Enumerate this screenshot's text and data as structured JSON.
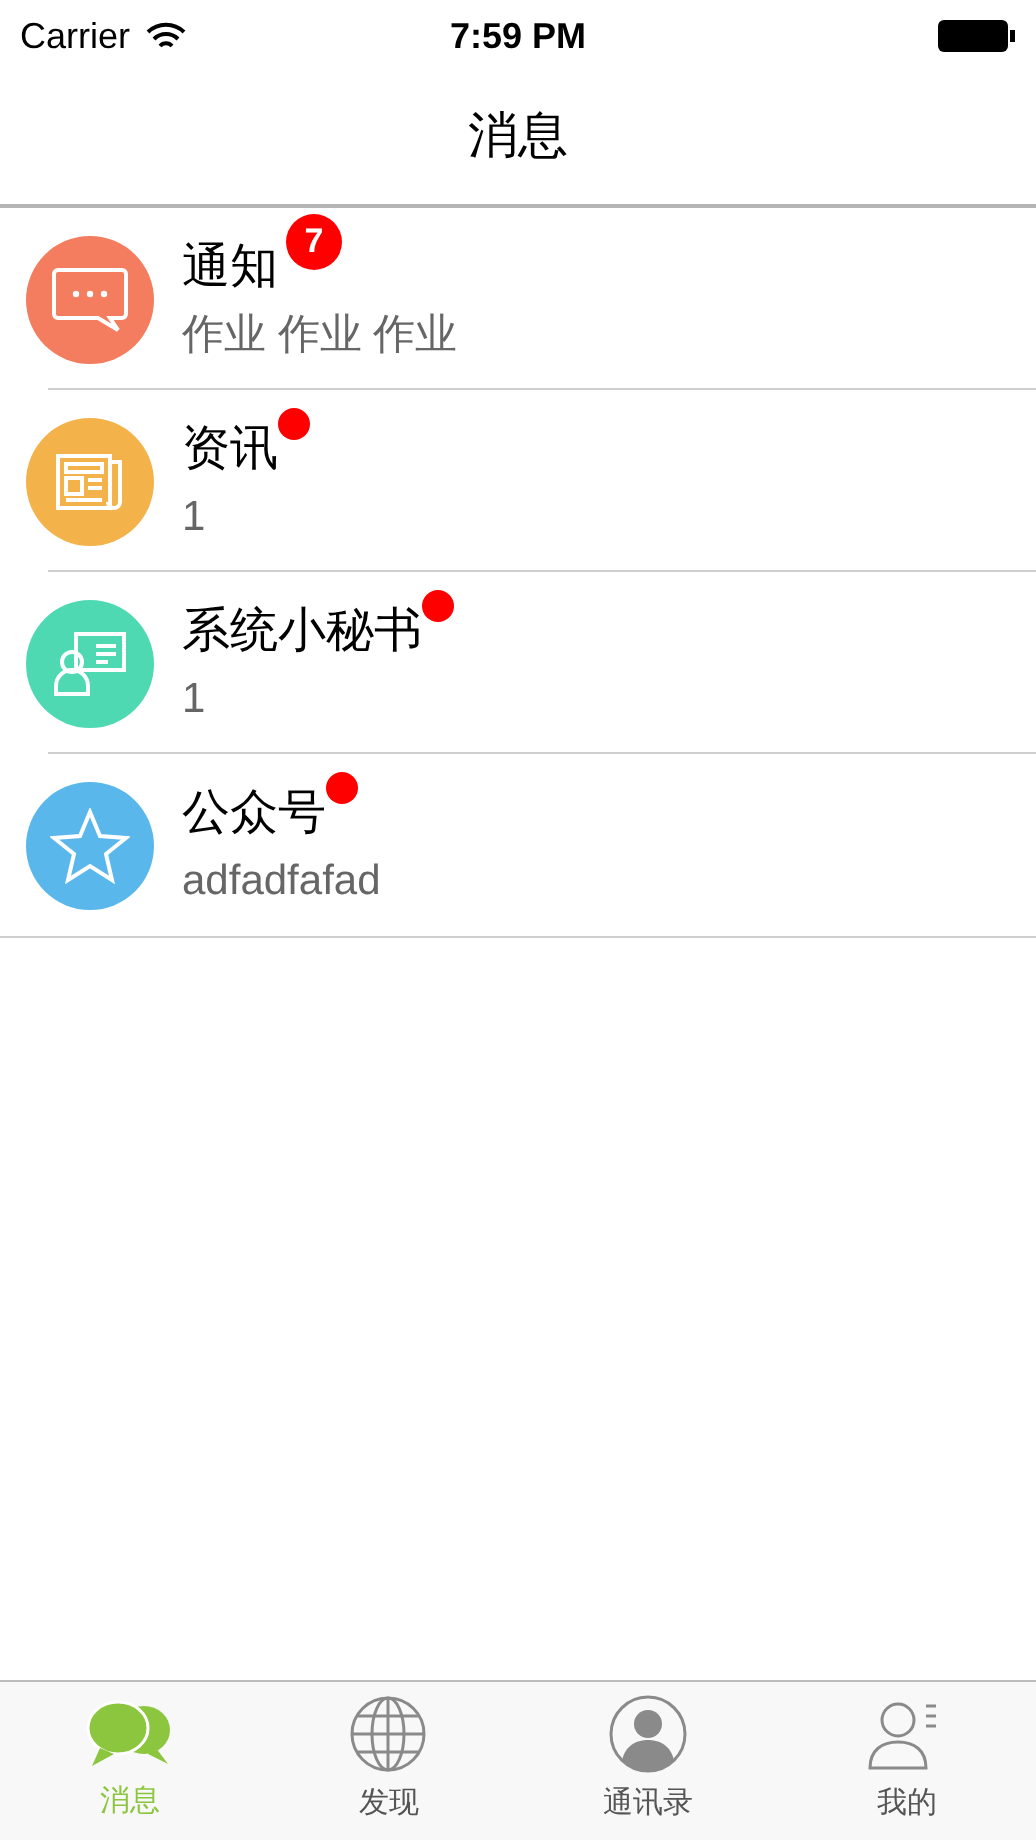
{
  "status_bar": {
    "carrier": "Carrier",
    "time": "7:59 PM"
  },
  "nav": {
    "title": "消息"
  },
  "items": [
    {
      "color": "#f47c5f",
      "title": "通知",
      "badge": {
        "kind": "count",
        "text": "7"
      },
      "subtitle": "作业 作业 作业"
    },
    {
      "color": "#f3b24a",
      "title": "资讯",
      "badge": {
        "kind": "dot"
      },
      "subtitle": "1"
    },
    {
      "color": "#4fd9b3",
      "title": "系统小秘书",
      "badge": {
        "kind": "dot"
      },
      "subtitle": "1"
    },
    {
      "color": "#5ab7ec",
      "title": "公众号",
      "badge": {
        "kind": "dot"
      },
      "subtitle": "adfadfafad"
    }
  ],
  "tabs": [
    {
      "label": "消息",
      "selected": true
    },
    {
      "label": "发现",
      "selected": false
    },
    {
      "label": "通讯录",
      "selected": false
    },
    {
      "label": "我的",
      "selected": false
    }
  ]
}
